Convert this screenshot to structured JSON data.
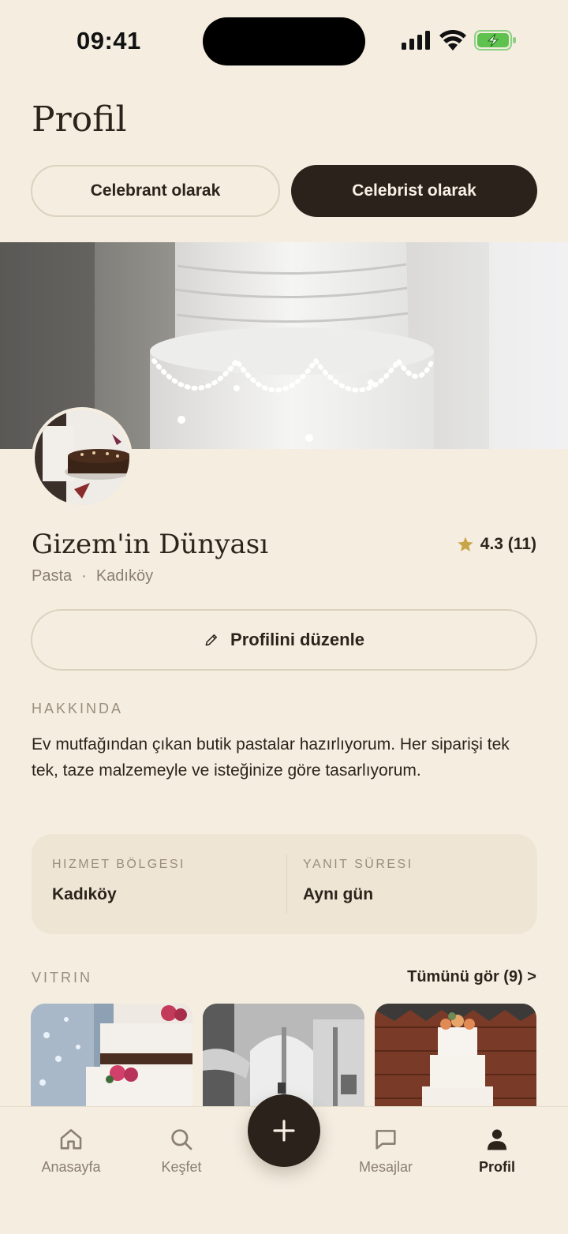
{
  "status": {
    "time": "09:41"
  },
  "header": {
    "title": "Profil"
  },
  "segments": [
    {
      "label": "Celebrant olarak",
      "active": false
    },
    {
      "label": "Celebrist olarak",
      "active": true
    }
  ],
  "profile": {
    "name": "Gizem'in Dünyası",
    "rating": "4.3 (11)",
    "category": "Pasta",
    "separator": "·",
    "location": "Kadıköy",
    "edit_label": "Profilini düzenle"
  },
  "about": {
    "label": "HAKKINDA",
    "text": "Ev mutfağından çıkan butik pastalar hazırlıyorum. Her siparişi tek tek, taze malzemeyle ve isteğinize göre tasarlıyorum."
  },
  "info": [
    {
      "label": "HIZMET BÖLGESI",
      "value": "Kadıköy"
    },
    {
      "label": "YANIT SÜRESI",
      "value": "Aynı gün"
    }
  ],
  "showcase": {
    "label": "VITRIN",
    "see_all": "Tümünü gör (9) >"
  },
  "tabs": [
    {
      "label": "Anasayfa",
      "icon": "home-icon"
    },
    {
      "label": "Keşfet",
      "icon": "search-icon"
    },
    {
      "label": "Mesajlar",
      "icon": "message-icon"
    },
    {
      "label": "Profil",
      "icon": "user-icon",
      "active": true
    }
  ],
  "colors": {
    "accent": "#2b231b",
    "background": "#f5ede0",
    "star": "#c9a54a"
  }
}
